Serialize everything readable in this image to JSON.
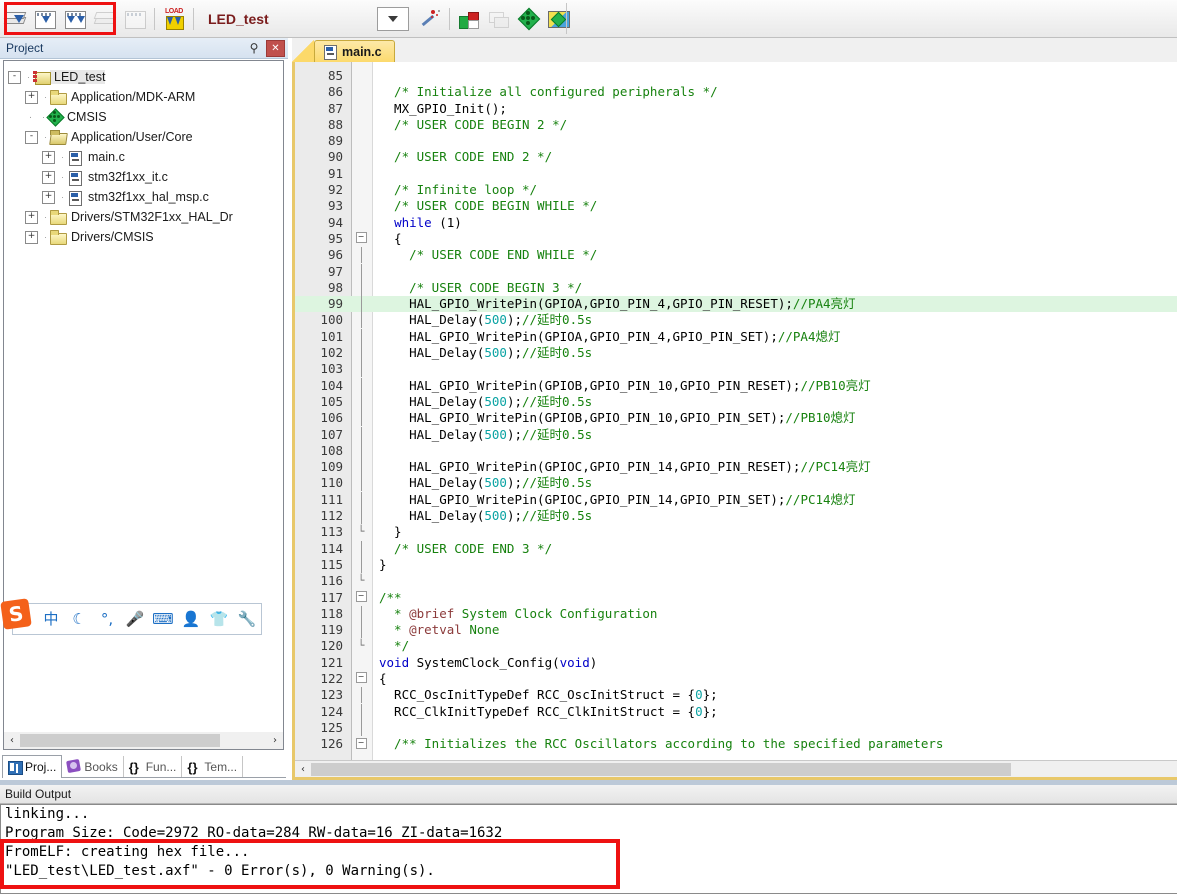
{
  "toolbar": {
    "project_name": "LED_test",
    "buttons": [
      {
        "name": "translate-file",
        "icon": "translate-icon",
        "enabled": true
      },
      {
        "name": "build-target",
        "icon": "build-icon",
        "enabled": true
      },
      {
        "name": "rebuild-all",
        "icon": "rebuild-icon",
        "enabled": true
      },
      {
        "name": "batch-build",
        "icon": "batch-build-icon",
        "enabled": false
      },
      {
        "name": "stop-build",
        "icon": "stop-build-icon",
        "enabled": false
      },
      {
        "name": "download",
        "icon": "load-icon",
        "label": "LOAD",
        "enabled": true
      }
    ],
    "target_selector_value": "",
    "right_buttons": [
      {
        "name": "configure-target",
        "icon": "magic-wand-icon"
      },
      {
        "name": "target-options",
        "icon": "target-options-icon"
      },
      {
        "name": "manage-components",
        "icon": "layers-icon"
      },
      {
        "name": "cmsis-config",
        "icon": "green-diamond-icon"
      },
      {
        "name": "pack-installer",
        "icon": "pack-installer-icon"
      }
    ]
  },
  "project_panel": {
    "title": "Project",
    "pin_icon": "pin-icon",
    "close_icon": "close-icon",
    "tree": [
      {
        "label": "LED_test",
        "depth": 0,
        "expander": "-",
        "icon": "project-icon",
        "selected": true
      },
      {
        "label": "Application/MDK-ARM",
        "depth": 1,
        "expander": "+",
        "icon": "folder-icon"
      },
      {
        "label": "CMSIS",
        "depth": 1,
        "expander": "",
        "icon": "cmsis-icon"
      },
      {
        "label": "Application/User/Core",
        "depth": 1,
        "expander": "-",
        "icon": "folder-open-icon"
      },
      {
        "label": "main.c",
        "depth": 2,
        "expander": "+",
        "icon": "c-file-icon"
      },
      {
        "label": "stm32f1xx_it.c",
        "depth": 2,
        "expander": "+",
        "icon": "c-file-icon"
      },
      {
        "label": "stm32f1xx_hal_msp.c",
        "depth": 2,
        "expander": "+",
        "icon": "c-file-icon"
      },
      {
        "label": "Drivers/STM32F1xx_HAL_Dr",
        "depth": 1,
        "expander": "+",
        "icon": "folder-icon"
      },
      {
        "label": "Drivers/CMSIS",
        "depth": 1,
        "expander": "+",
        "icon": "folder-icon"
      }
    ],
    "tabs": [
      {
        "label": "Proj...",
        "icon": "project-view-icon",
        "active": true
      },
      {
        "label": "Books",
        "icon": "books-icon",
        "active": false
      },
      {
        "label": "Fun...",
        "icon": "functions-icon",
        "active": false
      },
      {
        "label": "Tem...",
        "icon": "templates-icon",
        "active": false
      }
    ],
    "scroll_left_arrow": "‹",
    "scroll_right_arrow": "›"
  },
  "ime_bar": {
    "logo": "S",
    "icons": [
      "中",
      "☾",
      "°,",
      "🎤",
      "⌨",
      "👤",
      "👕",
      "🔧"
    ],
    "icon_names": [
      "chinese-mode-icon",
      "moon-icon",
      "punctuation-icon",
      "microphone-icon",
      "soft-keyboard-icon",
      "user-icon",
      "skin-icon",
      "settings-wrench-icon"
    ]
  },
  "editor": {
    "tabs": [
      {
        "label": "main.c",
        "icon": "c-file-icon",
        "active": true
      }
    ],
    "first_line_number": 85,
    "highlight_line": 99,
    "lines": [
      {
        "n": 85,
        "fold": "",
        "segs": []
      },
      {
        "n": 86,
        "fold": "",
        "segs": [
          {
            "t": "  /* Initialize all configured peripherals */",
            "c": "cm"
          }
        ]
      },
      {
        "n": 87,
        "fold": "",
        "segs": [
          {
            "t": "  MX_GPIO_Init();",
            "c": "plain"
          }
        ]
      },
      {
        "n": 88,
        "fold": "",
        "segs": [
          {
            "t": "  /* USER CODE BEGIN 2 */",
            "c": "cm"
          }
        ]
      },
      {
        "n": 89,
        "fold": "",
        "segs": []
      },
      {
        "n": 90,
        "fold": "",
        "segs": [
          {
            "t": "  /* USER CODE END 2 */",
            "c": "cm"
          }
        ]
      },
      {
        "n": 91,
        "fold": "",
        "segs": []
      },
      {
        "n": 92,
        "fold": "",
        "segs": [
          {
            "t": "  /* Infinite loop */",
            "c": "cm"
          }
        ]
      },
      {
        "n": 93,
        "fold": "",
        "segs": [
          {
            "t": "  /* USER CODE BEGIN WHILE */",
            "c": "cm"
          }
        ]
      },
      {
        "n": 94,
        "fold": "",
        "segs": [
          {
            "t": "  ",
            "c": "plain"
          },
          {
            "t": "while",
            "c": "kw"
          },
          {
            "t": " (1)",
            "c": "plain"
          }
        ]
      },
      {
        "n": 95,
        "fold": "box",
        "segs": [
          {
            "t": "  {",
            "c": "plain"
          }
        ]
      },
      {
        "n": 96,
        "fold": "bar",
        "segs": [
          {
            "t": "    /* USER CODE END WHILE */",
            "c": "cm"
          }
        ]
      },
      {
        "n": 97,
        "fold": "bar",
        "segs": []
      },
      {
        "n": 98,
        "fold": "bar",
        "segs": [
          {
            "t": "    /* USER CODE BEGIN 3 */",
            "c": "cm"
          }
        ]
      },
      {
        "n": 99,
        "fold": "bar",
        "segs": [
          {
            "t": "    HAL_GPIO_WritePin(GPIOA,GPIO_PIN_4,GPIO_PIN_RESET);",
            "c": "plain"
          },
          {
            "t": "//PA4亮灯",
            "c": "cm"
          }
        ]
      },
      {
        "n": 100,
        "fold": "bar",
        "segs": [
          {
            "t": "    HAL_Delay(",
            "c": "plain"
          },
          {
            "t": "500",
            "c": "num"
          },
          {
            "t": ");",
            "c": "plain"
          },
          {
            "t": "//延时0.5s",
            "c": "cm"
          }
        ]
      },
      {
        "n": 101,
        "fold": "bar",
        "segs": [
          {
            "t": "    HAL_GPIO_WritePin(GPIOA,GPIO_PIN_4,GPIO_PIN_SET);",
            "c": "plain"
          },
          {
            "t": "//PA4熄灯",
            "c": "cm"
          }
        ]
      },
      {
        "n": 102,
        "fold": "bar",
        "segs": [
          {
            "t": "    HAL_Delay(",
            "c": "plain"
          },
          {
            "t": "500",
            "c": "num"
          },
          {
            "t": ");",
            "c": "plain"
          },
          {
            "t": "//延时0.5s",
            "c": "cm"
          }
        ]
      },
      {
        "n": 103,
        "fold": "bar",
        "segs": []
      },
      {
        "n": 104,
        "fold": "bar",
        "segs": [
          {
            "t": "    HAL_GPIO_WritePin(GPIOB,GPIO_PIN_10,GPIO_PIN_RESET);",
            "c": "plain"
          },
          {
            "t": "//PB10亮灯",
            "c": "cm"
          }
        ]
      },
      {
        "n": 105,
        "fold": "bar",
        "segs": [
          {
            "t": "    HAL_Delay(",
            "c": "plain"
          },
          {
            "t": "500",
            "c": "num"
          },
          {
            "t": ");",
            "c": "plain"
          },
          {
            "t": "//延时0.5s",
            "c": "cm"
          }
        ]
      },
      {
        "n": 106,
        "fold": "bar",
        "segs": [
          {
            "t": "    HAL_GPIO_WritePin(GPIOB,GPIO_PIN_10,GPIO_PIN_SET);",
            "c": "plain"
          },
          {
            "t": "//PB10熄灯",
            "c": "cm"
          }
        ]
      },
      {
        "n": 107,
        "fold": "bar",
        "segs": [
          {
            "t": "    HAL_Delay(",
            "c": "plain"
          },
          {
            "t": "500",
            "c": "num"
          },
          {
            "t": ");",
            "c": "plain"
          },
          {
            "t": "//延时0.5s",
            "c": "cm"
          }
        ]
      },
      {
        "n": 108,
        "fold": "bar",
        "segs": []
      },
      {
        "n": 109,
        "fold": "bar",
        "segs": [
          {
            "t": "    HAL_GPIO_WritePin(GPIOC,GPIO_PIN_14,GPIO_PIN_RESET);",
            "c": "plain"
          },
          {
            "t": "//PC14亮灯",
            "c": "cm"
          }
        ]
      },
      {
        "n": 110,
        "fold": "bar",
        "segs": [
          {
            "t": "    HAL_Delay(",
            "c": "plain"
          },
          {
            "t": "500",
            "c": "num"
          },
          {
            "t": ");",
            "c": "plain"
          },
          {
            "t": "//延时0.5s",
            "c": "cm"
          }
        ]
      },
      {
        "n": 111,
        "fold": "bar",
        "segs": [
          {
            "t": "    HAL_GPIO_WritePin(GPIOC,GPIO_PIN_14,GPIO_PIN_SET);",
            "c": "plain"
          },
          {
            "t": "//PC14熄灯",
            "c": "cm"
          }
        ]
      },
      {
        "n": 112,
        "fold": "bar",
        "segs": [
          {
            "t": "    HAL_Delay(",
            "c": "plain"
          },
          {
            "t": "500",
            "c": "num"
          },
          {
            "t": ");",
            "c": "plain"
          },
          {
            "t": "//延时0.5s",
            "c": "cm"
          }
        ]
      },
      {
        "n": 113,
        "fold": "end",
        "segs": [
          {
            "t": "  }",
            "c": "plain"
          }
        ]
      },
      {
        "n": 114,
        "fold": "bar2",
        "segs": [
          {
            "t": "  /* USER CODE END 3 */",
            "c": "cm"
          }
        ]
      },
      {
        "n": 115,
        "fold": "bar2",
        "segs": [
          {
            "t": "}",
            "c": "plain"
          }
        ]
      },
      {
        "n": 116,
        "fold": "end2",
        "segs": []
      },
      {
        "n": 117,
        "fold": "box",
        "segs": [
          {
            "t": "/**",
            "c": "cm"
          }
        ]
      },
      {
        "n": 118,
        "fold": "bar",
        "segs": [
          {
            "t": "  * ",
            "c": "cm"
          },
          {
            "t": "@brief",
            "c": "docn"
          },
          {
            "t": " System Clock Configuration",
            "c": "cm"
          }
        ]
      },
      {
        "n": 119,
        "fold": "bar",
        "segs": [
          {
            "t": "  * ",
            "c": "cm"
          },
          {
            "t": "@retval",
            "c": "docn"
          },
          {
            "t": " None",
            "c": "cm"
          }
        ]
      },
      {
        "n": 120,
        "fold": "end",
        "segs": [
          {
            "t": "  */",
            "c": "cm"
          }
        ]
      },
      {
        "n": 121,
        "fold": "",
        "segs": [
          {
            "t": "",
            "c": "plain"
          },
          {
            "t": "void",
            "c": "kw"
          },
          {
            "t": " SystemClock_Config(",
            "c": "plain"
          },
          {
            "t": "void",
            "c": "kw"
          },
          {
            "t": ")",
            "c": "plain"
          }
        ]
      },
      {
        "n": 122,
        "fold": "box",
        "segs": [
          {
            "t": "{",
            "c": "plain"
          }
        ]
      },
      {
        "n": 123,
        "fold": "bar",
        "segs": [
          {
            "t": "  RCC_OscInitTypeDef RCC_OscInitStruct = {",
            "c": "plain"
          },
          {
            "t": "0",
            "c": "num"
          },
          {
            "t": "};",
            "c": "plain"
          }
        ]
      },
      {
        "n": 124,
        "fold": "bar",
        "segs": [
          {
            "t": "  RCC_ClkInitTypeDef RCC_ClkInitStruct = {",
            "c": "plain"
          },
          {
            "t": "0",
            "c": "num"
          },
          {
            "t": "};",
            "c": "plain"
          }
        ]
      },
      {
        "n": 125,
        "fold": "bar",
        "segs": []
      },
      {
        "n": 126,
        "fold": "box",
        "segs": [
          {
            "t": "  /** Initializes the RCC Oscillators according to the specified parameters",
            "c": "cm"
          }
        ]
      }
    ]
  },
  "build_output": {
    "title": "Build Output",
    "lines": [
      "linking...",
      "Program Size: Code=2972 RO-data=284 RW-data=16 ZI-data=1632",
      "FromELF: creating hex file...",
      "\"LED_test\\LED_test.axf\" - 0 Error(s), 0 Warning(s)."
    ]
  },
  "annotations": {
    "toolbar_box_color": "#ee1111",
    "build_box_color": "#ee1111"
  },
  "colors": {
    "highlight_line_bg": "#ddf5e0",
    "comment_green": "#17820f",
    "keyword_blue": "#0000c8",
    "number_teal": "#0aa3a3",
    "tab_yellow": "#fcd96a",
    "panel_blue": "#d6e2f0"
  }
}
